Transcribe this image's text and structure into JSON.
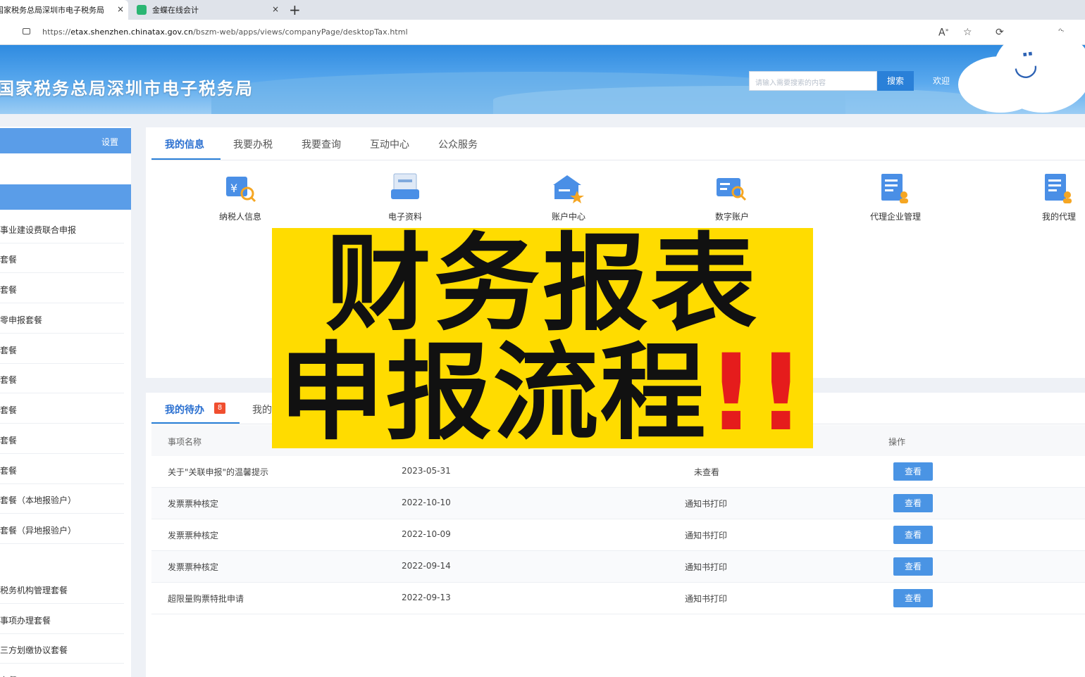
{
  "browser": {
    "tabs": [
      {
        "title": "国家税务总局深圳市电子税务局",
        "close": "×"
      },
      {
        "title": "金蝶在线会计",
        "close": "×"
      }
    ],
    "new_tab": "+",
    "url_scheme": "https://",
    "url_host": "etax.shenzhen.chinatax.gov.cn",
    "url_path": "/bszm-web/apps/views/companyPage/desktopTax.html"
  },
  "header": {
    "site_title": "国家税务总局深圳市电子税务局",
    "search_placeholder": "请输入需要搜索的内容",
    "search_button": "搜索",
    "welcome": "欢迎"
  },
  "sidebar": {
    "settings": "设置",
    "items": [
      "事业建设费联合申报",
      "套餐",
      "套餐",
      "零申报套餐",
      "套餐",
      "套餐",
      "套餐",
      "套餐",
      "套餐",
      "套餐（本地报验户）",
      "套餐（异地报验户）",
      "税务机构管理套餐",
      "事项办理套餐",
      "三方划缴协议套餐",
      "套餐"
    ]
  },
  "nav": {
    "tabs": [
      "我的信息",
      "我要办税",
      "我要查询",
      "互动中心",
      "公众服务"
    ],
    "quick": [
      {
        "label": "纳税人信息",
        "icon": "taxpayer-info-icon"
      },
      {
        "label": "电子资料",
        "icon": "electronic-docs-icon"
      },
      {
        "label": "账户中心",
        "icon": "account-center-icon"
      },
      {
        "label": "数字账户",
        "icon": "digital-account-icon"
      },
      {
        "label": "代理企业管理",
        "icon": "agency-manage-icon"
      },
      {
        "label": "我的代理",
        "icon": "my-agent-icon"
      }
    ]
  },
  "todo": {
    "tab": "我的待办",
    "badge": "8",
    "tab2": "我的",
    "headers": {
      "name": "事项名称",
      "op": "操作"
    },
    "view_label": "查看",
    "rows": [
      {
        "name": "关于\"关联申报\"的温馨提示",
        "date": "2023-05-31",
        "status": "未查看"
      },
      {
        "name": "发票票种核定",
        "date": "2022-10-10",
        "status": "通知书打印"
      },
      {
        "name": "发票票种核定",
        "date": "2022-10-09",
        "status": "通知书打印"
      },
      {
        "name": "发票票种核定",
        "date": "2022-09-14",
        "status": "通知书打印"
      },
      {
        "name": "超限量购票特批申请",
        "date": "2022-09-13",
        "status": "通知书打印"
      }
    ]
  },
  "overlay": {
    "line1": "财务报表",
    "line2": "申报流程",
    "marks": "!!"
  },
  "colors": {
    "accent": "#2a80d8",
    "overlay_bg": "#ffdc00",
    "marks": "#e51c1c"
  }
}
